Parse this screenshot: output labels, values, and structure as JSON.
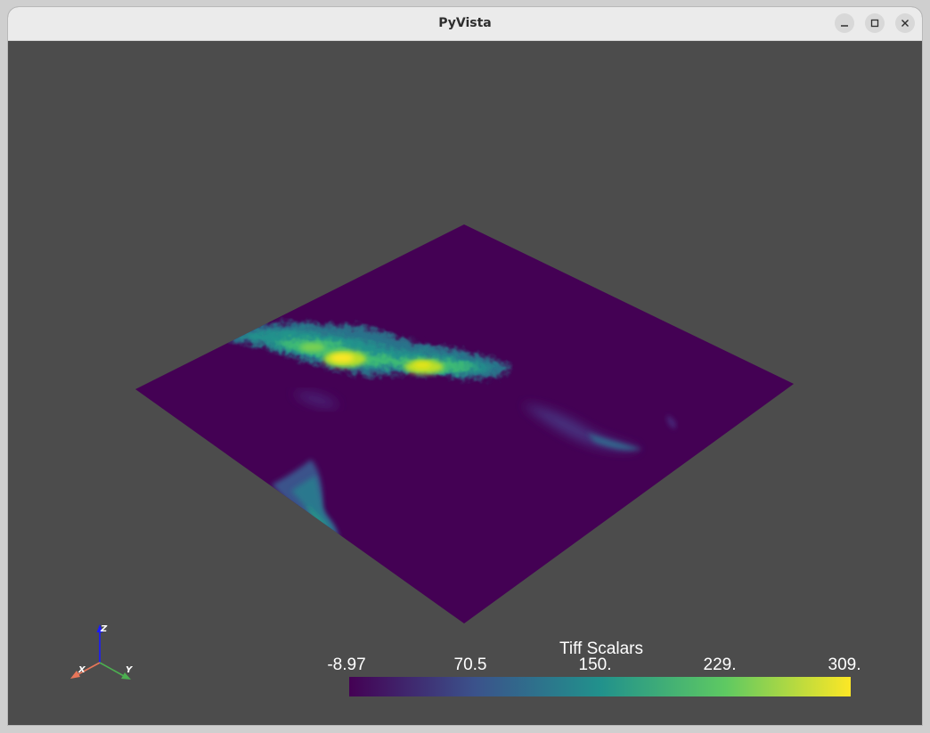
{
  "window": {
    "title": "PyVista",
    "controls": {
      "minimize": "minimize-icon",
      "maximize": "maximize-icon",
      "close": "close-icon"
    }
  },
  "scene": {
    "background_color": "#4c4c4c",
    "surface_base_color": "#440154",
    "colormap": "viridis",
    "axes_labels": {
      "x": "X",
      "y": "Y",
      "z": "Z"
    },
    "axes_colors": {
      "x": "#e8765a",
      "y": "#4caf50",
      "z": "#1a1aff"
    }
  },
  "scalar_bar": {
    "title": "Tiff Scalars",
    "min": -8.97,
    "max": 309,
    "ticks": [
      "-8.97",
      "70.5",
      "150.",
      "229.",
      "309."
    ],
    "colors": [
      "#440154",
      "#3b528b",
      "#21918c",
      "#5ec962",
      "#fde725"
    ]
  }
}
